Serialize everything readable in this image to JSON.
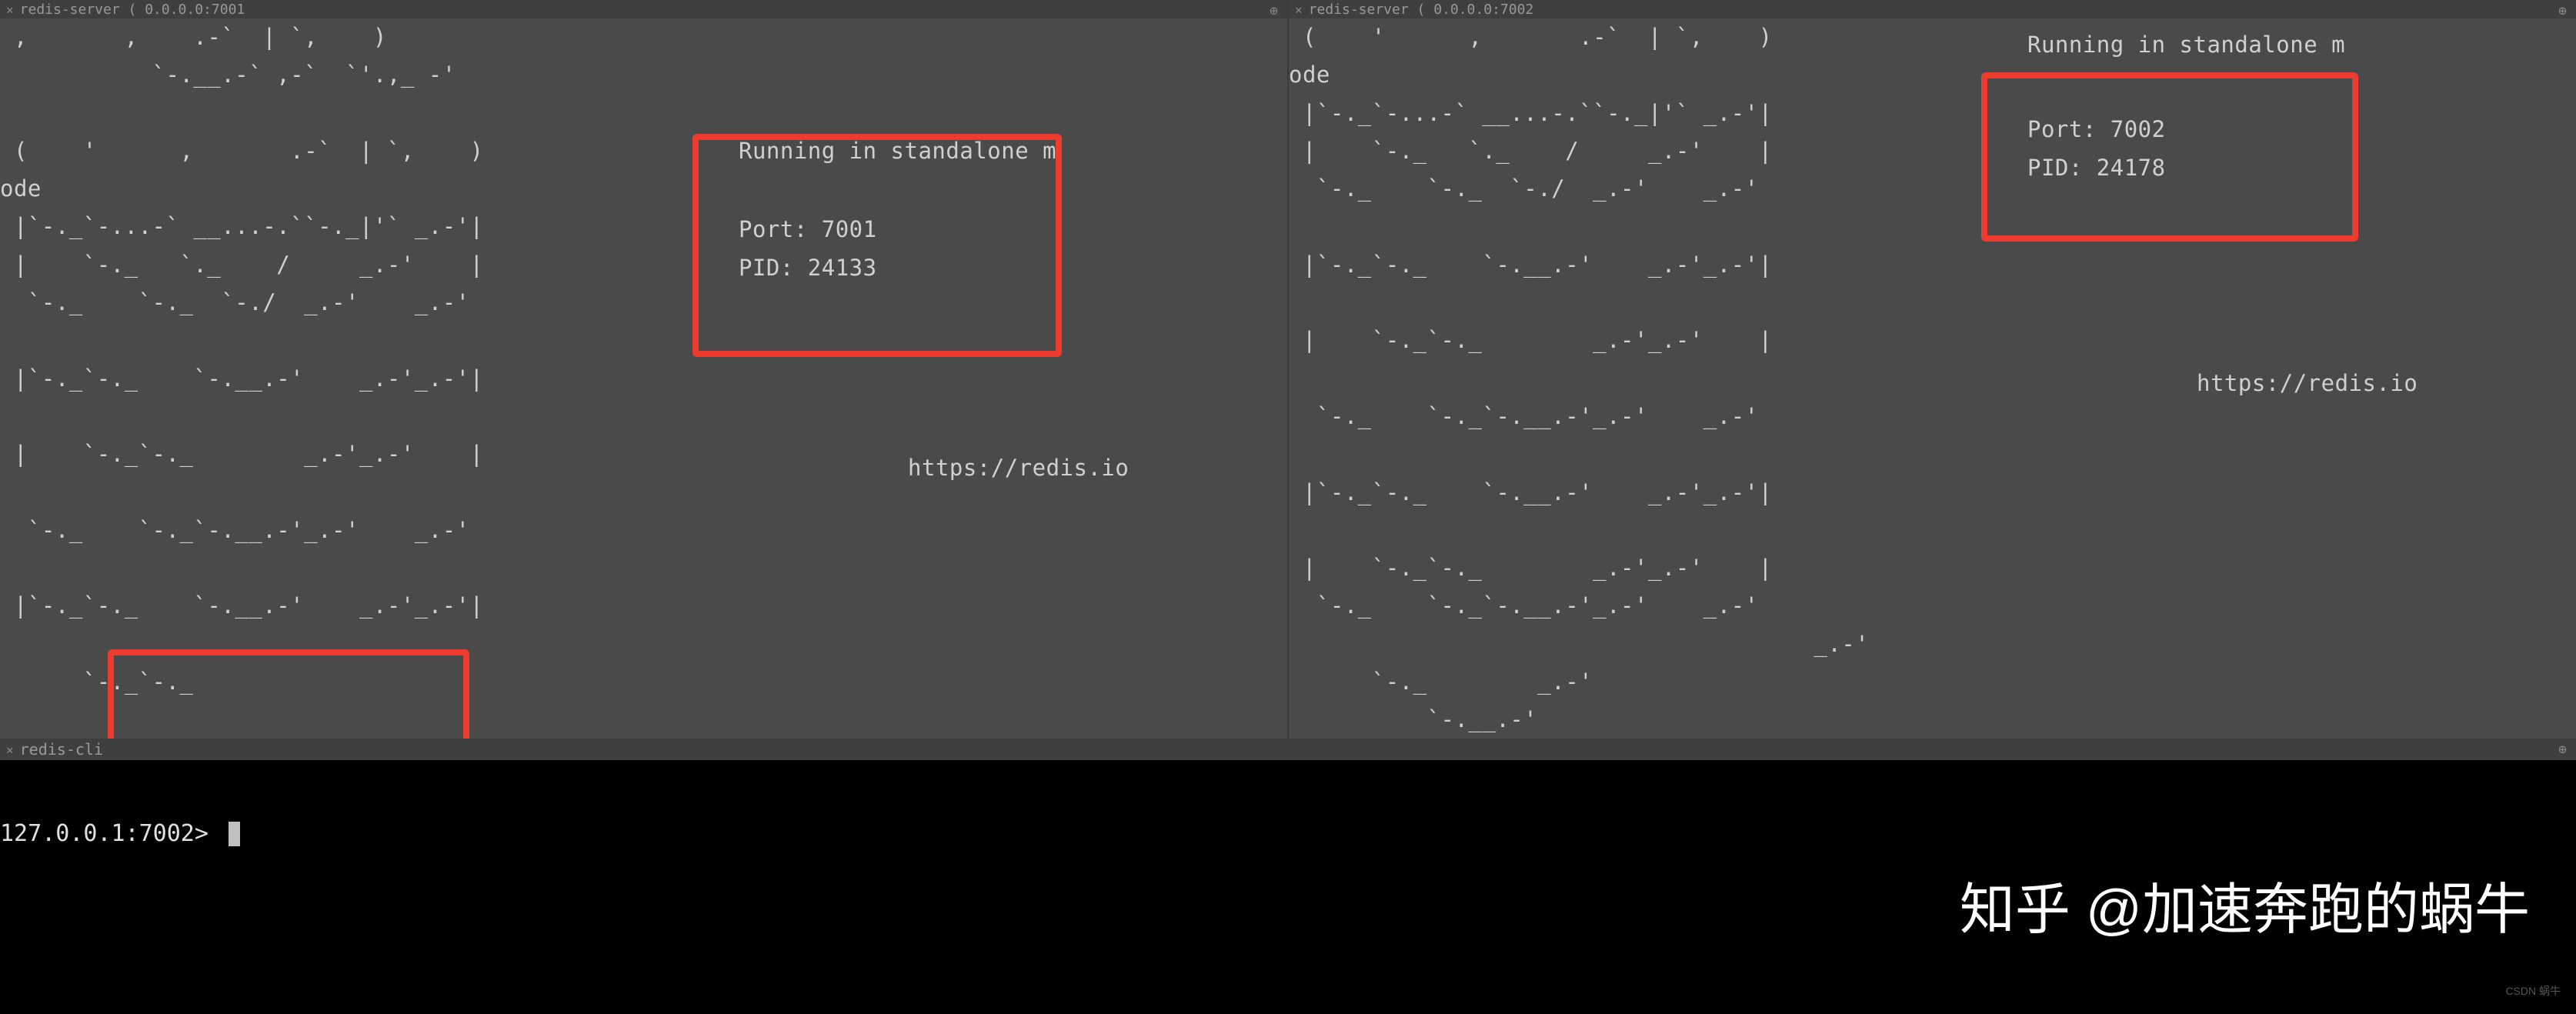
{
  "leftPane": {
    "tabTitle": "redis-server ( 0.0.0.0:7001",
    "ascii": " ,       ,    .-`  | `,    )\n           `-.__.-` ,-`  `'.,_ -'\n\n (    '      ,       .-`  | `,    )     Running in standalone m\node\n |`-._`-...-` __...-.``-._|'` _.-'|     Port: 7001\n |    `-._   `._    /     _.-'    |     PID: 24133\n  `-._    `-._  `-./  _.-'    _.-'\n\n |`-._`-._    `-.__.-'    _.-'_.-'|\n\n |    `-._`-._        _.-'_.-'    |         https://redis.io\n\n  `-._    `-._`-.__.-'_.-'    _.-'\n\n |`-._`-._    `-.__.-'    _.-'_.-'|\n\n      `-._`-._\n",
    "runningText": "Running in standalone m",
    "odeText": "ode",
    "port": "Port: 7001",
    "pid": "PID: 24133",
    "url": "https://redis.io"
  },
  "rightPane": {
    "tabTitle": "redis-server ( 0.0.0.0:7002",
    "runningText": "Running in standalone m",
    "odeText": "ode",
    "port": "Port: 7002",
    "pid": "PID: 24178",
    "url": "https://redis.io"
  },
  "cliPane": {
    "tabTitle": "redis-cli",
    "prompt": "127.0.0.1:7002> "
  },
  "watermark": "知乎 @加速奔跑的蜗牛",
  "watermark2": "CSDN 蜗牛"
}
